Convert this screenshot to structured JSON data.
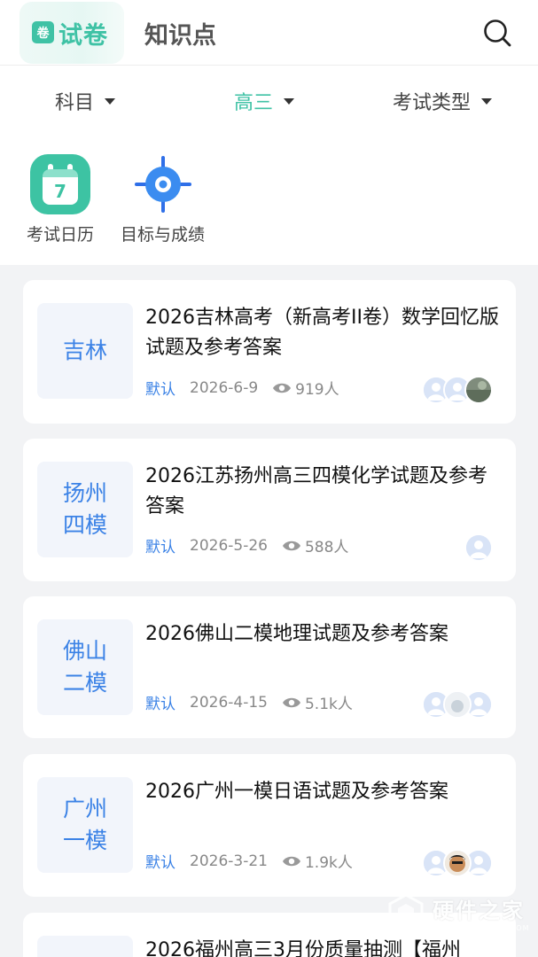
{
  "header": {
    "active_tab": {
      "badge": "卷",
      "label": "试卷"
    },
    "other_tab": "知识点",
    "search_icon": "search-icon"
  },
  "filters": {
    "subject": "科目",
    "grade": "高三",
    "exam_type": "考试类型"
  },
  "tools": [
    {
      "label": "考试日历",
      "icon": "calendar-icon",
      "day": "7"
    },
    {
      "label": "目标与成绩",
      "icon": "target-icon"
    }
  ],
  "colors": {
    "accent": "#3fc2a5",
    "blue": "#3b82e6",
    "background": "#f2f3f5"
  },
  "cards": [
    {
      "thumb": [
        "吉林"
      ],
      "title": "2026吉林高考（新高考II卷）数学回忆版试题及参考答案",
      "tag": "默认",
      "date": "2026-6-9",
      "views": "919人",
      "avatar_count": 3
    },
    {
      "thumb": [
        "扬州",
        "四模"
      ],
      "title": "2026江苏扬州高三四模化学试题及参考答案",
      "tag": "默认",
      "date": "2026-5-26",
      "views": "588人",
      "avatar_count": 1
    },
    {
      "thumb": [
        "佛山",
        "二模"
      ],
      "title": "2026佛山二模地理试题及参考答案",
      "tag": "默认",
      "date": "2026-4-15",
      "views": "5.1k人",
      "avatar_count": 3
    },
    {
      "thumb": [
        "广州",
        "一模"
      ],
      "title": "2026广州一模日语试题及参考答案",
      "tag": "默认",
      "date": "2026-3-21",
      "views": "1.9k人",
      "avatar_count": 3
    },
    {
      "thumb": [],
      "title": "2026福州高三3月份质量抽测【福州",
      "tag": "",
      "date": "",
      "views": "",
      "avatar_count": 0
    }
  ],
  "watermark": {
    "main": "硬件之家",
    "sub": "YING JIAN ZHI JIA.COM"
  }
}
